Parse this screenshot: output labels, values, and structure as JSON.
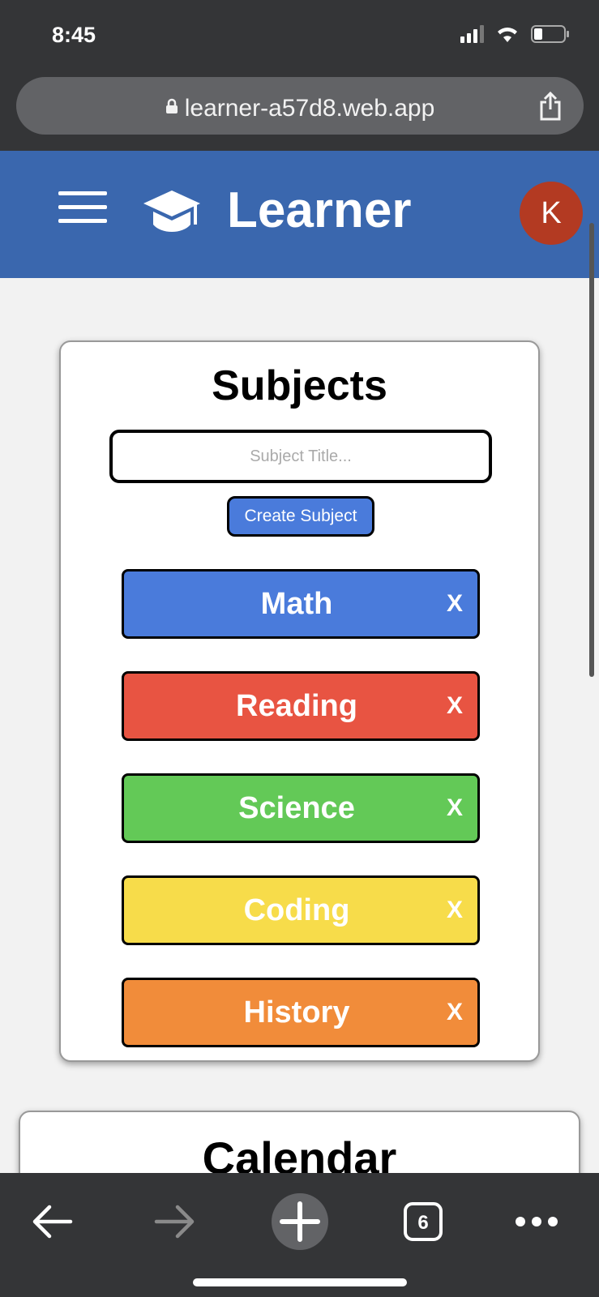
{
  "status_bar": {
    "time": "8:45"
  },
  "browser": {
    "url": "learner-a57d8.web.app",
    "tab_count": "6"
  },
  "header": {
    "app_title": "Learner",
    "avatar_initial": "K"
  },
  "subjects": {
    "title": "Subjects",
    "input_placeholder": "Subject Title...",
    "create_label": "Create Subject",
    "items": [
      {
        "name": "Math",
        "delete": "X",
        "color": "#4a7bdb"
      },
      {
        "name": "Reading",
        "delete": "X",
        "color": "#e85442"
      },
      {
        "name": "Science",
        "delete": "X",
        "color": "#63c957"
      },
      {
        "name": "Coding",
        "delete": "X",
        "color": "#f7dc4a"
      },
      {
        "name": "History",
        "delete": "X",
        "color": "#f18c3a"
      }
    ]
  },
  "calendar": {
    "title": "Calendar"
  }
}
